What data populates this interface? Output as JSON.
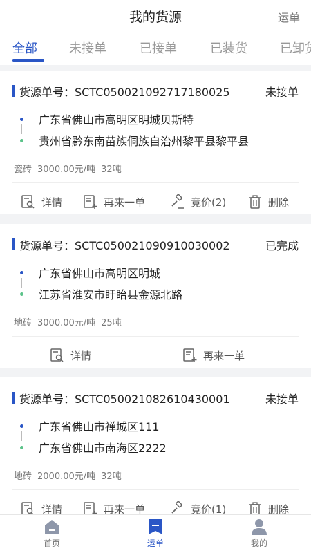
{
  "header": {
    "title": "我的货源",
    "right_label": "运单"
  },
  "tabs": [
    "全部",
    "未接单",
    "已接单",
    "已装货",
    "已卸货"
  ],
  "accent_color": "#2a56c6",
  "cards": [
    {
      "id_label": "货源单号：",
      "id": "SCTC050021092717180025",
      "status": "未接单",
      "from": "广东省佛山市高明区明城贝斯特",
      "to": "贵州省黔东南苗族侗族自治州黎平县黎平县",
      "goods": "瓷砖",
      "price": "3000.00元/吨",
      "weight": "32吨",
      "actions": [
        "详情",
        "再来一单",
        "竞价(2)",
        "删除"
      ]
    },
    {
      "id_label": "货源单号：",
      "id": "SCTC050021090910030002",
      "status": "已完成",
      "from": "广东省佛山市高明区明城",
      "to": "江苏省淮安市盱眙县金源北路",
      "goods": "地砖",
      "price": "3000.00元/吨",
      "weight": "25吨",
      "actions": [
        "详情",
        "再来一单"
      ]
    },
    {
      "id_label": "货源单号：",
      "id": "SCTC050021082610430001",
      "status": "未接单",
      "from": "广东省佛山市禅城区111",
      "to": "广东省佛山市南海区2222",
      "goods": "地砖",
      "price": "2000.00元/吨",
      "weight": "32吨",
      "actions": [
        "详情",
        "再来一单",
        "竞价(1)",
        "删除"
      ]
    }
  ],
  "bottom_nav": [
    "首页",
    "运单",
    "我的"
  ]
}
